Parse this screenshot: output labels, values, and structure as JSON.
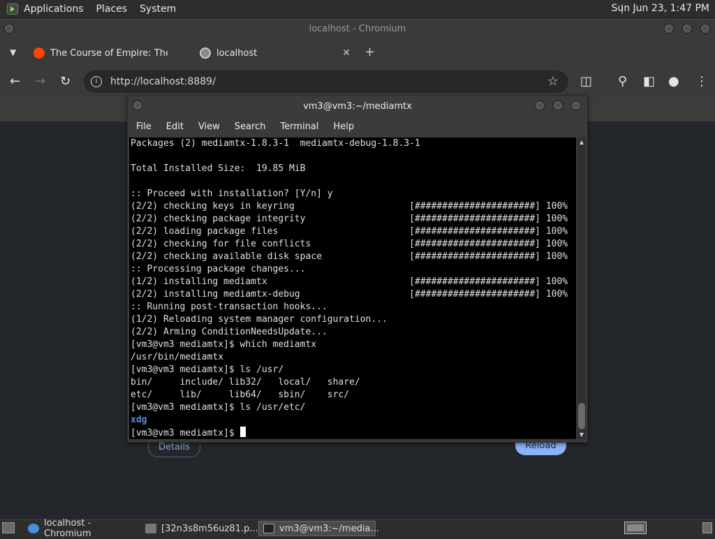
{
  "top_panel": {
    "menus": [
      "Applications",
      "Places",
      "System"
    ],
    "clock": "Sun Jun 23,  1:47 PM"
  },
  "browser": {
    "window_title": "localhost - Chromium",
    "tabs": [
      {
        "label": "The Course of Empire: The Co",
        "favicon": "reddit-icon",
        "active": false
      },
      {
        "label": "localhost",
        "favicon": "globe-icon",
        "active": true
      }
    ],
    "url": "http://localhost:8889/",
    "page": {
      "details_label": "Details",
      "reload_label": "Reload"
    }
  },
  "terminal": {
    "title": "vm3@vm3:~/mediamtx",
    "menus": [
      "File",
      "Edit",
      "View",
      "Search",
      "Terminal",
      "Help"
    ],
    "lines": [
      "Packages (2) mediamtx-1.8.3-1  mediamtx-debug-1.8.3-1",
      "",
      "Total Installed Size:  19.85 MiB",
      "",
      ":: Proceed with installation? [Y/n] y",
      "(2/2) checking keys in keyring                     [######################] 100%",
      "(2/2) checking package integrity                   [######################] 100%",
      "(2/2) loading package files                        [######################] 100%",
      "(2/2) checking for file conflicts                  [######################] 100%",
      "(2/2) checking available disk space                [######################] 100%",
      ":: Processing package changes...",
      "(1/2) installing mediamtx                          [######################] 100%",
      "(2/2) installing mediamtx-debug                    [######################] 100%",
      ":: Running post-transaction hooks...",
      "(1/2) Reloading system manager configuration...",
      "(2/2) Arming ConditionNeedsUpdate...",
      "[vm3@vm3 mediamtx]$ which mediamtx",
      "/usr/bin/mediamtx",
      "[vm3@vm3 mediamtx]$ ls /usr/",
      "bin/     include/ lib32/   local/   share/",
      "etc/     lib/     lib64/   sbin/    src/",
      "[vm3@vm3 mediamtx]$ ls /usr/etc/"
    ],
    "dir_line": "xdg",
    "prompt": "[vm3@vm3 mediamtx]$ "
  },
  "taskbar": {
    "items": [
      {
        "label": "localhost - Chromium",
        "icon": "chromium-icon",
        "active": false
      },
      {
        "label": "[32n3s8m56uz81.p...",
        "icon": "image-viewer-icon",
        "active": false
      },
      {
        "label": "vm3@vm3:~/media...",
        "icon": "terminal-icon",
        "active": true
      }
    ]
  },
  "colors": {
    "accent_blue": "#8ab4f8",
    "terminal_dir": "#5b8fd6"
  }
}
